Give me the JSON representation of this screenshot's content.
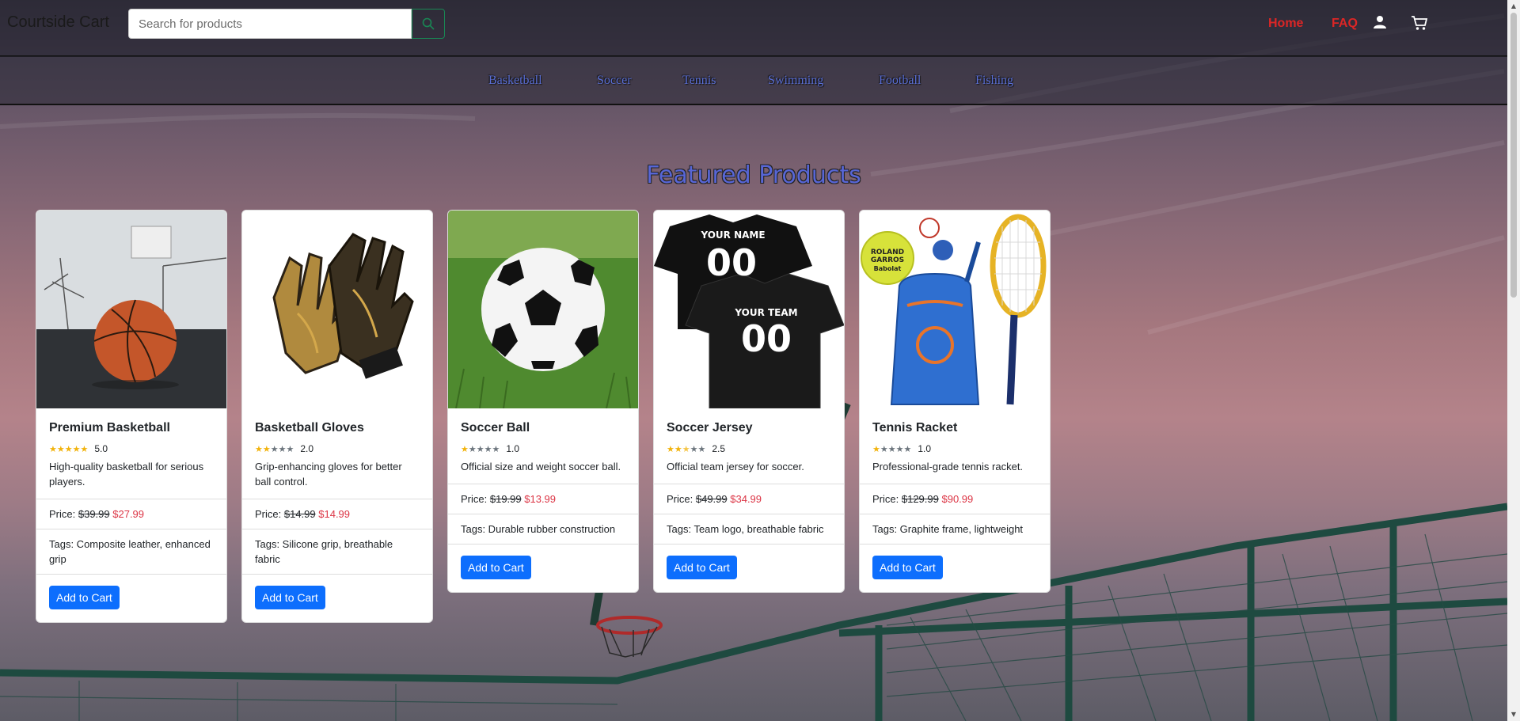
{
  "header": {
    "brand": "Courtside Cart",
    "search_placeholder": "Search for products",
    "nav": {
      "home": "Home",
      "faq": "FAQ"
    }
  },
  "categories": [
    "Basketball",
    "Soccer",
    "Tennis",
    "Swimming",
    "Football",
    "Fishing"
  ],
  "section_title": "Featured Products",
  "products": [
    {
      "name": "Premium Basketball",
      "rating": 5,
      "rating_text": "5.0",
      "description": "High-quality basketball for serious players.",
      "price_label": "Price:",
      "old_price": "$39.99",
      "new_price": "$27.99",
      "tags": "Tags: Composite leather, enhanced grip",
      "button": "Add to Cart"
    },
    {
      "name": "Basketball Gloves",
      "rating": 2,
      "rating_text": "2.0",
      "description": "Grip-enhancing gloves for better ball control.",
      "price_label": "Price:",
      "old_price": "$14.99",
      "new_price": "$14.99",
      "tags": "Tags: Silicone grip, breathable fabric",
      "button": "Add to Cart"
    },
    {
      "name": "Soccer Ball",
      "rating": 1,
      "rating_text": "1.0",
      "description": "Official size and weight soccer ball.",
      "price_label": "Price:",
      "old_price": "$19.99",
      "new_price": "$13.99",
      "tags": "Tags: Durable rubber construction",
      "button": "Add to Cart"
    },
    {
      "name": "Soccer Jersey",
      "rating": 2.5,
      "rating_text": "2.5",
      "description": "Official team jersey for soccer.",
      "price_label": "Price:",
      "old_price": "$49.99",
      "new_price": "$34.99",
      "tags": "Tags: Team logo, breathable fabric",
      "button": "Add to Cart",
      "image_text": {
        "top_label": "YOUR NAME",
        "top_number": "00",
        "bottom_label": "YOUR TEAM",
        "bottom_number": "00"
      }
    },
    {
      "name": "Tennis Racket",
      "rating": 1,
      "rating_text": "1.0",
      "description": "Professional-grade tennis racket.",
      "price_label": "Price:",
      "old_price": "$129.99",
      "new_price": "$90.99",
      "tags": "Tags: Graphite frame, lightweight",
      "button": "Add to Cart",
      "image_text": {
        "ball_line1": "ROLAND",
        "ball_line2": "GARROS",
        "ball_brand": "Babolat"
      }
    }
  ],
  "colors": {
    "accent_red": "#dc2626",
    "button_blue": "#0d6efd",
    "category_blue": "#5b6fd6",
    "price_red": "#dc3545",
    "star_gold": "#f2b30c"
  }
}
